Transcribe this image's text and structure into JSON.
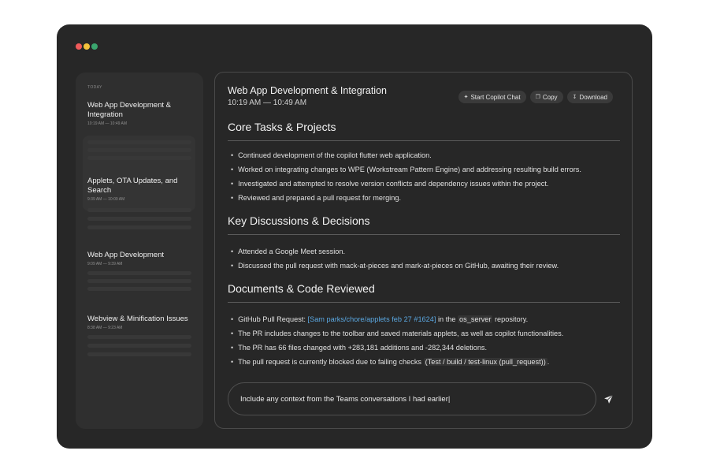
{
  "window": {
    "traffic_colors": [
      "#ef5a5a",
      "#f3c13b",
      "#3aa56e"
    ]
  },
  "sidebar": {
    "section_label": "TODAY",
    "sessions": [
      {
        "title": "Web App Development & Integration",
        "time": "10:19 AM — 10:49 AM"
      },
      {
        "title": "Applets, OTA Updates, and Search",
        "time": "9:39 AM — 10:09 AM"
      },
      {
        "title": "Web App Development",
        "time": "9:09 AM — 9:39 AM"
      },
      {
        "title": "Webview & Minification Issues",
        "time": "8:38 AM — 9:23 AM"
      }
    ]
  },
  "main": {
    "title": "Web App Development & Integration",
    "time": "10:19 AM — 10:49 AM",
    "actions": {
      "copilot": "Start Copilot Chat",
      "copy": "Copy",
      "download": "Download"
    },
    "sections": [
      {
        "heading": "Core Tasks & Projects",
        "bullets": [
          "Continued development of the copilot flutter web application.",
          "Worked on integrating changes to WPE (Workstream Pattern Engine) and addressing resulting build errors.",
          "Investigated and attempted to resolve version conflicts and dependency issues within the project.",
          "Reviewed and prepared a pull request for merging."
        ]
      },
      {
        "heading": "Key Discussions & Decisions",
        "bullets": [
          "Attended a Google Meet session.",
          "Discussed the pull request with mack-at-pieces and mark-at-pieces on GitHub, awaiting their review."
        ]
      },
      {
        "heading": "Documents & Code Reviewed",
        "pr_prefix": "GitHub Pull Request: ",
        "pr_link": "[Sam parks/chore/applets feb 27 #1624]",
        "pr_mid": " in the ",
        "pr_repo": "os_server",
        "pr_suffix": " repository.",
        "bullets": [
          "The PR includes changes to the toolbar and saved materials applets, as well as copilot functionalities.",
          "The PR has 66 files changed with +283,181 additions and -282,344 deletions."
        ],
        "blocked_prefix": "The pull request is currently blocked due to failing checks ",
        "blocked_code": "(Test / build / test-linux (pull_request))",
        "blocked_suffix": "."
      }
    ]
  },
  "composer": {
    "value": "Include any context from the Teams conversations I had earlier|"
  },
  "colors": {
    "window_bg": "#272727",
    "link": "#5aa7e0"
  }
}
